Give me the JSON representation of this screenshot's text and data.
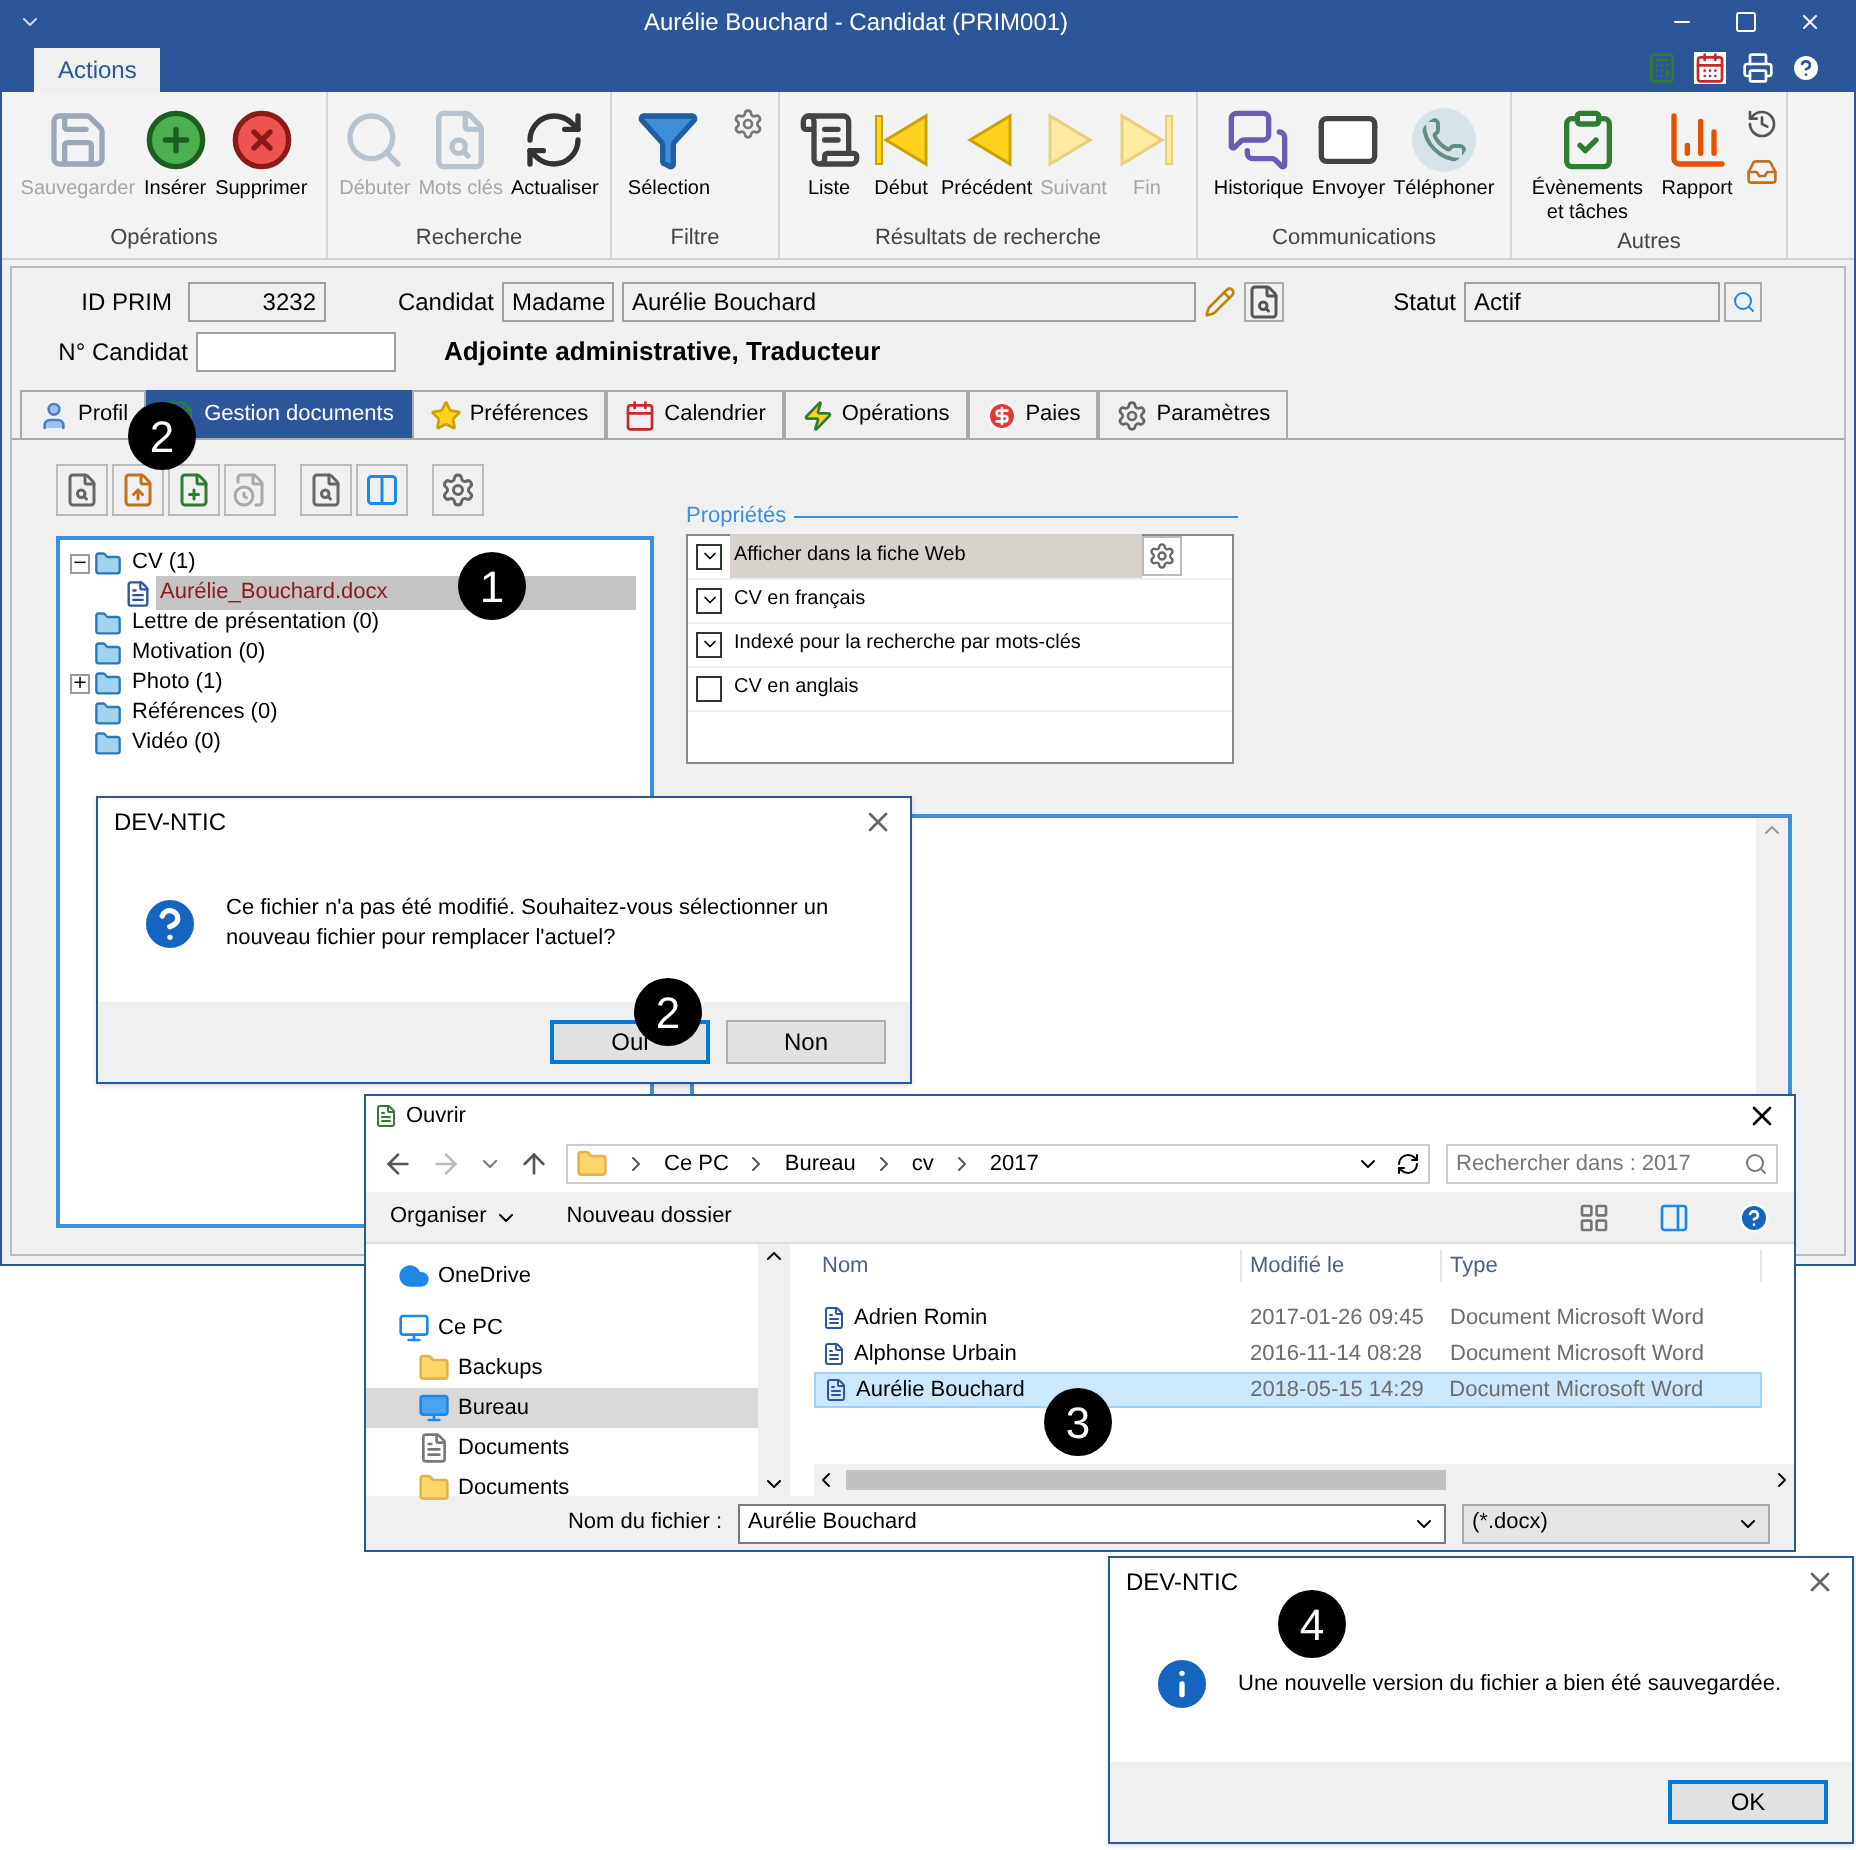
{
  "window": {
    "title": "Aurélie Bouchard - Candidat (PRIM001)"
  },
  "ribbon_tabs": [
    {
      "label": "Actions",
      "selected": true
    }
  ],
  "ribbon_groups": [
    {
      "label": "Opérations",
      "buttons": [
        {
          "label": "Sauvegarder",
          "disabled": true
        },
        {
          "label": "Insérer",
          "disabled": false
        },
        {
          "label": "Supprimer",
          "disabled": false
        }
      ]
    },
    {
      "label": "Recherche",
      "buttons": [
        {
          "label": "Débuter",
          "disabled": true
        },
        {
          "label": "Mots clés",
          "disabled": true
        },
        {
          "label": "Actualiser",
          "disabled": false
        }
      ]
    },
    {
      "label": "Filtre",
      "buttons": [
        {
          "label": "Sélection",
          "disabled": false
        }
      ]
    },
    {
      "label": "Résultats de recherche",
      "buttons": [
        {
          "label": "Liste",
          "disabled": false
        },
        {
          "label": "Début",
          "disabled": false
        },
        {
          "label": "Précédent",
          "disabled": false
        },
        {
          "label": "Suivant",
          "disabled": true
        },
        {
          "label": "Fin",
          "disabled": true
        }
      ]
    },
    {
      "label": "Communications",
      "buttons": [
        {
          "label": "Historique",
          "disabled": false
        },
        {
          "label": "Envoyer",
          "disabled": false
        },
        {
          "label": "Téléphoner",
          "disabled": false
        }
      ]
    },
    {
      "label": "Autres",
      "buttons": [
        {
          "label": "Évènements et tâches",
          "disabled": false
        },
        {
          "label": "Rapport",
          "disabled": false
        }
      ]
    }
  ],
  "form": {
    "id_label": "ID PRIM",
    "id_value": "3232",
    "candidate_label": "Candidat",
    "salutation": "Madame",
    "name": "Aurélie Bouchard",
    "status_label": "Statut",
    "status": "Actif",
    "number_label": "N° Candidat",
    "subtitle": "Adjointe administrative, Traducteur"
  },
  "tabs": [
    {
      "label": "Profil",
      "selected": false
    },
    {
      "label": "Gestion documents",
      "selected": true
    },
    {
      "label": "Préférences",
      "selected": false
    },
    {
      "label": "Calendrier",
      "selected": false
    },
    {
      "label": "Opérations",
      "selected": false
    },
    {
      "label": "Paies",
      "selected": false
    },
    {
      "label": "Paramètres",
      "selected": false
    }
  ],
  "tree": [
    {
      "label": "CV (1)",
      "kind": "folder",
      "toggle": "−",
      "selected": false,
      "children": [
        {
          "label": "Aurélie_Bouchard.docx",
          "kind": "file",
          "selected": true
        }
      ]
    },
    {
      "label": "Lettre de présentation (0)",
      "kind": "folder",
      "selected": false
    },
    {
      "label": "Motivation (0)",
      "kind": "folder",
      "selected": false
    },
    {
      "label": "Photo (1)",
      "kind": "folder",
      "toggle": "+",
      "selected": false
    },
    {
      "label": "Références (0)",
      "kind": "folder",
      "selected": false
    },
    {
      "label": "Vidéo (0)",
      "kind": "folder",
      "selected": false
    }
  ],
  "properties": {
    "title": "Propriétés",
    "items": [
      {
        "label": "Afficher dans la fiche Web",
        "checked": true,
        "selected": true
      },
      {
        "label": "CV en français",
        "checked": true,
        "selected": false
      },
      {
        "label": "Indexé pour la recherche par mots-clés",
        "checked": true,
        "selected": false
      },
      {
        "label": "CV en anglais",
        "checked": false,
        "selected": false
      }
    ]
  },
  "question_dialog": {
    "title": "DEV-NTIC",
    "message": "Ce fichier n'a pas été modifié. Souhaitez-vous sélectionner un nouveau fichier pour remplacer l'actuel?",
    "buttons": [
      {
        "label": "Oui",
        "default": true
      },
      {
        "label": "Non",
        "default": false
      }
    ]
  },
  "open_dialog": {
    "title": "Ouvrir",
    "path": [
      "Ce PC",
      "Bureau",
      "cv",
      "2017"
    ],
    "search": {
      "placeholder": "Rechercher dans : 2017"
    },
    "toolbar": [
      "Organiser",
      "Nouveau dossier"
    ],
    "nav": [
      {
        "label": "OneDrive",
        "selected": false
      },
      {
        "label": "Ce PC",
        "selected": false
      },
      {
        "label": "Backups",
        "selected": false
      },
      {
        "label": "Bureau",
        "selected": true
      },
      {
        "label": "Documents",
        "selected": false
      },
      {
        "label": "Documents",
        "selected": false
      }
    ],
    "columns": [
      "Nom",
      "Modifié le",
      "Type"
    ],
    "rows": [
      {
        "name": "Adrien Romin",
        "modified": "2017-01-26 09:45",
        "type": "Document Microsoft Word",
        "selected": false
      },
      {
        "name": "Alphonse Urbain",
        "modified": "2016-11-14 08:28",
        "type": "Document Microsoft Word",
        "selected": false
      },
      {
        "name": "Aurélie Bouchard",
        "modified": "2018-05-15 14:29",
        "type": "Document Microsoft Word",
        "selected": true
      }
    ],
    "filename_label": "Nom du fichier :",
    "filename": "Aurélie Bouchard",
    "filter": "(*.docx)"
  },
  "info_dialog": {
    "title": "DEV-NTIC",
    "message": "Une nouvelle version du fichier a bien été sauvegardée.",
    "buttons": [
      {
        "label": "OK",
        "default": true
      }
    ]
  },
  "callouts": [
    {
      "label": "2"
    },
    {
      "label": "1"
    },
    {
      "label": "2"
    },
    {
      "label": "3"
    },
    {
      "label": "4"
    }
  ]
}
